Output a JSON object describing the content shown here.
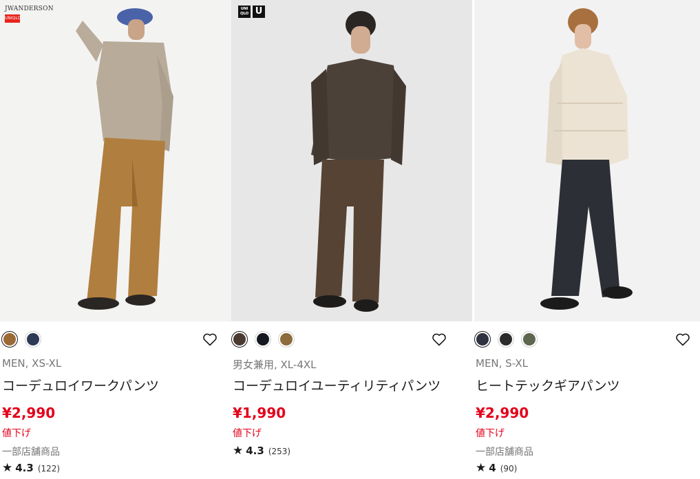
{
  "products": [
    {
      "brand_logo_text": "JWANDERSON",
      "brand_logo_sub": "UNIQLO",
      "swatch_colors": [
        "#9b6a34",
        "#2c3a55"
      ],
      "gender_size": "MEN, XS-XL",
      "name": "コーデュロイワークパンツ",
      "price": "¥2,990",
      "sale_label": "値下げ",
      "stock_label": "一部店舗商品",
      "rating": "4.3",
      "review_count": "(122)"
    },
    {
      "brand_logo_top": "UNI QLO",
      "brand_logo_u": "U",
      "swatch_colors": [
        "#4b3a30",
        "#151820",
        "#8c6b3c"
      ],
      "gender_size": "男女兼用, XL-4XL",
      "name": "コーデュロイユーティリティパンツ",
      "price": "¥1,990",
      "sale_label": "値下げ",
      "rating": "4.3",
      "review_count": "(253)"
    },
    {
      "swatch_colors": [
        "#2f3240",
        "#2b2b2b",
        "#5e6650"
      ],
      "gender_size": "MEN, S-XL",
      "name": "ヒートテックギアパンツ",
      "price": "¥2,990",
      "sale_label": "値下げ",
      "stock_label": "一部店舗商品",
      "rating": "4",
      "review_count": "(90)"
    }
  ],
  "icons": {
    "favorite": "heart-outline-icon",
    "rating": "star-icon"
  },
  "colors": {
    "price_red": "#e3001b",
    "muted_text": "#767676"
  }
}
